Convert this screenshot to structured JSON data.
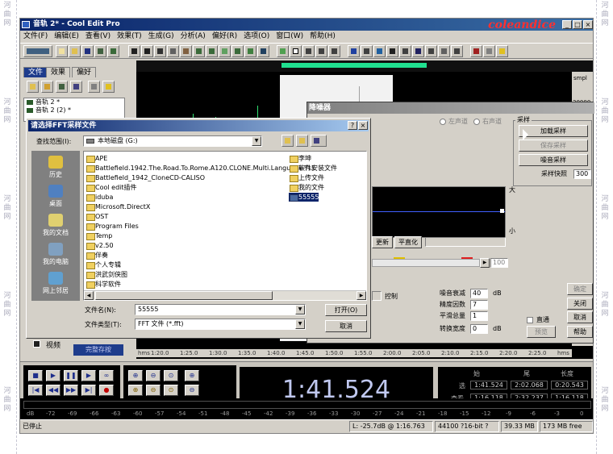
{
  "watermark": {
    "chars": [
      "河",
      "曲",
      "网"
    ]
  },
  "window": {
    "title": "音轨 2* - Cool Edit Pro",
    "brand": "coleandice",
    "buttons": {
      "minimize": "_",
      "maximize": "□",
      "close": "×"
    }
  },
  "menu": [
    "文件(F)",
    "编辑(E)",
    "查看(V)",
    "效果(T)",
    "生成(G)",
    "分析(A)",
    "偏好(R)",
    "选项(O)",
    "窗口(W)",
    "帮助(H)"
  ],
  "organizer": {
    "tabs": [
      "文件",
      "效果",
      "偏好"
    ],
    "files": [
      "音轨 2 *",
      "音轨 2 (2) *"
    ],
    "bottom_tab": "视频",
    "bottom_btn": "完整存按"
  },
  "waveform": {
    "ruler_top_label": "smpl",
    "ruler_right_value": "20000",
    "ruler_bottom_label": "smpl",
    "time_ruler": [
      "hms",
      "1:20.0",
      "1:25.0",
      "1:30.0",
      "1:35.0",
      "1:40.0",
      "1:45.0",
      "1:50.0",
      "1:55.0",
      "2:00.0",
      "2:05.0",
      "2:10.0",
      "2:15.0",
      "2:20.0",
      "2:25.0",
      "hms"
    ]
  },
  "transport": {
    "time": "1:41.524",
    "sel_headers": [
      "始",
      "尾",
      "长度"
    ],
    "sel_rows": [
      {
        "label": "选",
        "start": "1:41.524",
        "end": "2:02.068",
        "length": "0:20.543"
      },
      {
        "label": "查看",
        "start": "1:16.118",
        "end": "2:32.237",
        "length": "1:16.118"
      }
    ]
  },
  "meter": {
    "scale": [
      "dB",
      "-72",
      "-69",
      "-66",
      "-63",
      "-60",
      "-57",
      "-54",
      "-51",
      "-48",
      "-45",
      "-42",
      "-39",
      "-36",
      "-33",
      "-30",
      "-27",
      "-24",
      "-21",
      "-18",
      "-15",
      "-12",
      "-9",
      "-6",
      "-3",
      "0"
    ]
  },
  "status": {
    "left": "已停止",
    "level": "L: -25.7dB @  1:16.763",
    "format": "44100 ?16-bit ?Stereo",
    "size": "39.33 MB",
    "free": "173 MB free"
  },
  "noise_dialog": {
    "title": "降噪器",
    "left_channel": "左声道",
    "right_channel": "右声道",
    "sample_group": "采样",
    "add_sample": "加载采样",
    "save_sample": "保存采样",
    "noise_sample": "噪音采样",
    "snapshot_label": "采样快照",
    "snapshot_value": "300",
    "graph_high": "大",
    "graph_low": "小",
    "graph_label_high": "高",
    "refresh": "更新",
    "flatten": "平直化",
    "slider_value": "100",
    "control_label": "控制",
    "noise_reduce_label": "噪音衰减",
    "noise_reduce_value": "40",
    "precision_label": "精度因数",
    "precision_value": "7",
    "smooth_label": "平滑总量",
    "smooth_value": "1",
    "transition_label": "转换宽度",
    "transition_value": "0",
    "db_unit": "dB",
    "bypass": "直通",
    "ok": "确定",
    "close": "关闭",
    "preview": "预览",
    "cancel": "取消",
    "help": "帮助"
  },
  "open_dialog": {
    "title": "请选择FFT采样文件",
    "help_btn": "?",
    "close_btn": "×",
    "lookin_label": "查找范围(I):",
    "lookin_value": "本地磁盘 (G:)",
    "places": [
      "历史",
      "桌面",
      "我的文档",
      "我的电脑",
      "网上邻居"
    ],
    "col1": [
      "APE",
      "Battlefield.1942.The.Road.To.Rome.A120.CLONE.Multi.Language-TLF",
      "Battlefield_1942_CloneCD-CALISO",
      "Cool edit插件",
      "iduba",
      "Microsoft.DirectX",
      "OST",
      "Program Files",
      "Temp",
      "v2.50",
      "伴奏",
      "个人专辑",
      "洪武剑侠图",
      "科学软件"
    ],
    "col2": [
      "李坤",
      "软件安装文件",
      "上传文件",
      "我的文件"
    ],
    "selected_file": "55555",
    "filename_label": "文件名(N):",
    "filename_value": "55555",
    "filetype_label": "文件类型(T):",
    "filetype_value": "FFT 文件 (*.fft)",
    "open_btn": "打开(O)",
    "cancel_btn": "取消"
  }
}
